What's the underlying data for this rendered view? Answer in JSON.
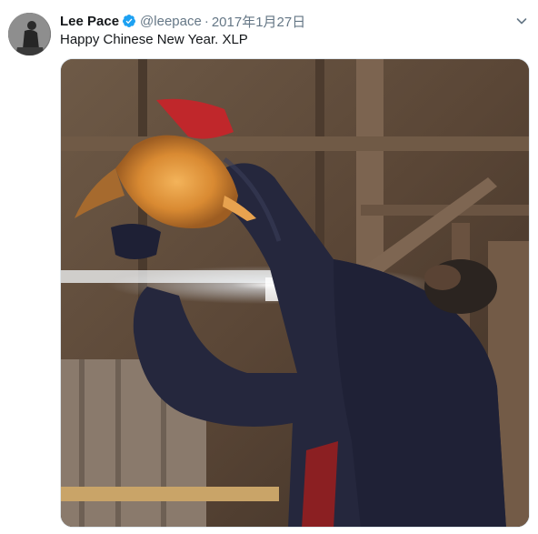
{
  "user": {
    "display_name": "Lee Pace",
    "handle": "@leepace",
    "separator": "·",
    "date": "2017年1月27日",
    "verified": true
  },
  "tweet": {
    "text": "Happy Chinese New Year. XLP"
  },
  "icons": {
    "verified": "verified-badge-icon",
    "menu": "chevron-down-icon"
  },
  "colors": {
    "verified_blue": "#1da1f2",
    "secondary_text": "#657786",
    "primary_text": "#14171a"
  }
}
